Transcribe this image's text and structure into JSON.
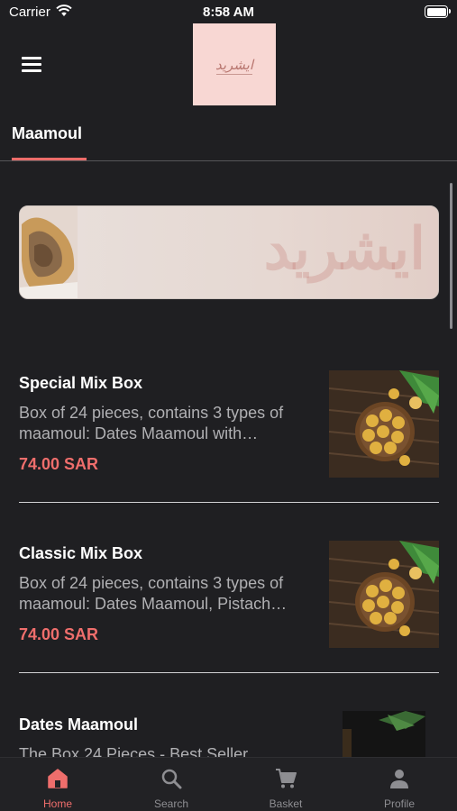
{
  "status_bar": {
    "carrier": "Carrier",
    "time": "8:58 AM"
  },
  "header": {
    "logo_text": "ايشريد",
    "menu_icon": "hamburger-icon"
  },
  "tabs": [
    {
      "label": "Maamoul",
      "active": true
    }
  ],
  "banner": {
    "watermark": "ايشريد"
  },
  "products": [
    {
      "title": "Special Mix Box",
      "description": "Box of 24 pieces, contains 3 types of maamoul: Dates Maamoul with…",
      "price": "74.00 SAR"
    },
    {
      "title": "Classic Mix Box",
      "description": "Box of 24 pieces, contains 3 types of maamoul: Dates Maamoul, Pistach…",
      "price": "74.00 SAR"
    },
    {
      "title": "Dates Maamoul",
      "description": "The Box 24 Pieces - Best Seller",
      "price": ""
    }
  ],
  "bottom_nav": [
    {
      "label": "Home",
      "icon": "home-icon",
      "active": true
    },
    {
      "label": "Search",
      "icon": "search-icon",
      "active": false
    },
    {
      "label": "Basket",
      "icon": "cart-icon",
      "active": false
    },
    {
      "label": "Profile",
      "icon": "person-icon",
      "active": false
    }
  ],
  "colors": {
    "background": "#1f1f22",
    "accent": "#ef6e6c",
    "logo_bg": "#f8d7d3"
  }
}
